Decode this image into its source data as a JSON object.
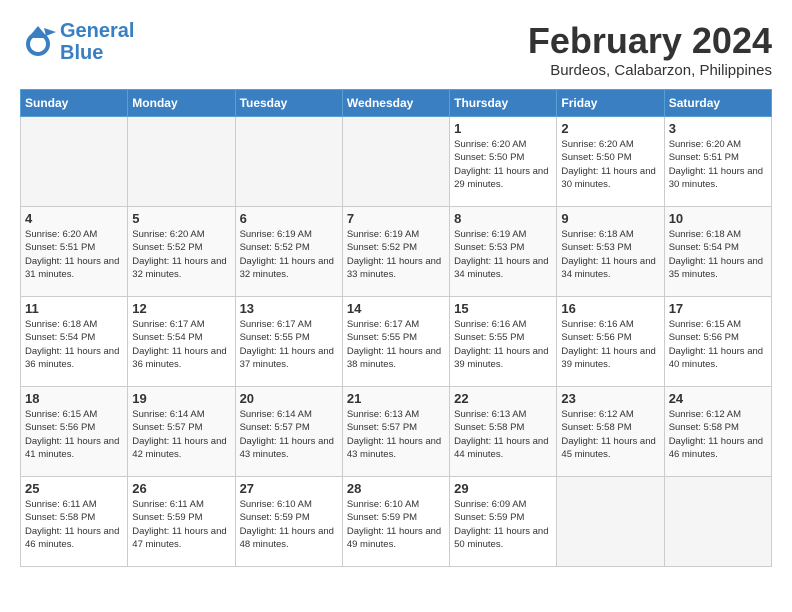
{
  "header": {
    "logo_line1": "General",
    "logo_line2": "Blue",
    "month": "February 2024",
    "location": "Burdeos, Calabarzon, Philippines"
  },
  "weekdays": [
    "Sunday",
    "Monday",
    "Tuesday",
    "Wednesday",
    "Thursday",
    "Friday",
    "Saturday"
  ],
  "weeks": [
    [
      {
        "day": "",
        "info": ""
      },
      {
        "day": "",
        "info": ""
      },
      {
        "day": "",
        "info": ""
      },
      {
        "day": "",
        "info": ""
      },
      {
        "day": "1",
        "info": "Sunrise: 6:20 AM\nSunset: 5:50 PM\nDaylight: 11 hours\nand 29 minutes."
      },
      {
        "day": "2",
        "info": "Sunrise: 6:20 AM\nSunset: 5:50 PM\nDaylight: 11 hours\nand 30 minutes."
      },
      {
        "day": "3",
        "info": "Sunrise: 6:20 AM\nSunset: 5:51 PM\nDaylight: 11 hours\nand 30 minutes."
      }
    ],
    [
      {
        "day": "4",
        "info": "Sunrise: 6:20 AM\nSunset: 5:51 PM\nDaylight: 11 hours\nand 31 minutes."
      },
      {
        "day": "5",
        "info": "Sunrise: 6:20 AM\nSunset: 5:52 PM\nDaylight: 11 hours\nand 32 minutes."
      },
      {
        "day": "6",
        "info": "Sunrise: 6:19 AM\nSunset: 5:52 PM\nDaylight: 11 hours\nand 32 minutes."
      },
      {
        "day": "7",
        "info": "Sunrise: 6:19 AM\nSunset: 5:52 PM\nDaylight: 11 hours\nand 33 minutes."
      },
      {
        "day": "8",
        "info": "Sunrise: 6:19 AM\nSunset: 5:53 PM\nDaylight: 11 hours\nand 34 minutes."
      },
      {
        "day": "9",
        "info": "Sunrise: 6:18 AM\nSunset: 5:53 PM\nDaylight: 11 hours\nand 34 minutes."
      },
      {
        "day": "10",
        "info": "Sunrise: 6:18 AM\nSunset: 5:54 PM\nDaylight: 11 hours\nand 35 minutes."
      }
    ],
    [
      {
        "day": "11",
        "info": "Sunrise: 6:18 AM\nSunset: 5:54 PM\nDaylight: 11 hours\nand 36 minutes."
      },
      {
        "day": "12",
        "info": "Sunrise: 6:17 AM\nSunset: 5:54 PM\nDaylight: 11 hours\nand 36 minutes."
      },
      {
        "day": "13",
        "info": "Sunrise: 6:17 AM\nSunset: 5:55 PM\nDaylight: 11 hours\nand 37 minutes."
      },
      {
        "day": "14",
        "info": "Sunrise: 6:17 AM\nSunset: 5:55 PM\nDaylight: 11 hours\nand 38 minutes."
      },
      {
        "day": "15",
        "info": "Sunrise: 6:16 AM\nSunset: 5:55 PM\nDaylight: 11 hours\nand 39 minutes."
      },
      {
        "day": "16",
        "info": "Sunrise: 6:16 AM\nSunset: 5:56 PM\nDaylight: 11 hours\nand 39 minutes."
      },
      {
        "day": "17",
        "info": "Sunrise: 6:15 AM\nSunset: 5:56 PM\nDaylight: 11 hours\nand 40 minutes."
      }
    ],
    [
      {
        "day": "18",
        "info": "Sunrise: 6:15 AM\nSunset: 5:56 PM\nDaylight: 11 hours\nand 41 minutes."
      },
      {
        "day": "19",
        "info": "Sunrise: 6:14 AM\nSunset: 5:57 PM\nDaylight: 11 hours\nand 42 minutes."
      },
      {
        "day": "20",
        "info": "Sunrise: 6:14 AM\nSunset: 5:57 PM\nDaylight: 11 hours\nand 43 minutes."
      },
      {
        "day": "21",
        "info": "Sunrise: 6:13 AM\nSunset: 5:57 PM\nDaylight: 11 hours\nand 43 minutes."
      },
      {
        "day": "22",
        "info": "Sunrise: 6:13 AM\nSunset: 5:58 PM\nDaylight: 11 hours\nand 44 minutes."
      },
      {
        "day": "23",
        "info": "Sunrise: 6:12 AM\nSunset: 5:58 PM\nDaylight: 11 hours\nand 45 minutes."
      },
      {
        "day": "24",
        "info": "Sunrise: 6:12 AM\nSunset: 5:58 PM\nDaylight: 11 hours\nand 46 minutes."
      }
    ],
    [
      {
        "day": "25",
        "info": "Sunrise: 6:11 AM\nSunset: 5:58 PM\nDaylight: 11 hours\nand 46 minutes."
      },
      {
        "day": "26",
        "info": "Sunrise: 6:11 AM\nSunset: 5:59 PM\nDaylight: 11 hours\nand 47 minutes."
      },
      {
        "day": "27",
        "info": "Sunrise: 6:10 AM\nSunset: 5:59 PM\nDaylight: 11 hours\nand 48 minutes."
      },
      {
        "day": "28",
        "info": "Sunrise: 6:10 AM\nSunset: 5:59 PM\nDaylight: 11 hours\nand 49 minutes."
      },
      {
        "day": "29",
        "info": "Sunrise: 6:09 AM\nSunset: 5:59 PM\nDaylight: 11 hours\nand 50 minutes."
      },
      {
        "day": "",
        "info": ""
      },
      {
        "day": "",
        "info": ""
      }
    ]
  ]
}
